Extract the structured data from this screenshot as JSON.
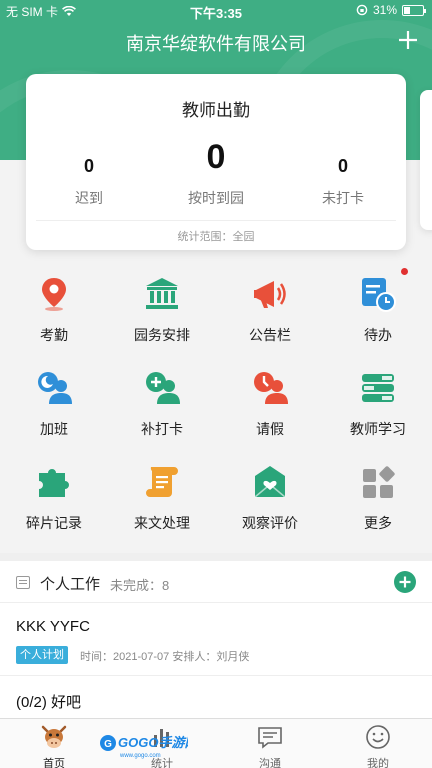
{
  "status_bar": {
    "carrier": "无 SIM 卡",
    "time": "下午3:35",
    "battery": "31%",
    "battery_level": 0.31
  },
  "header": {
    "title": "南京华绽软件有限公司",
    "add_icon": "plus-icon"
  },
  "attendance": {
    "title": "教师出勤",
    "stats": [
      {
        "value": "0",
        "label": "迟到"
      },
      {
        "value": "0",
        "label": "按时到园"
      },
      {
        "value": "0",
        "label": "未打卡"
      }
    ],
    "scope": "统计范围：全园"
  },
  "menu": [
    {
      "label": "考勤",
      "icon": "location-pin-icon",
      "color": "#e8503a"
    },
    {
      "label": "园务安排",
      "icon": "building-icon",
      "color": "#2aa57a"
    },
    {
      "label": "公告栏",
      "icon": "megaphone-icon",
      "color": "#e8503a"
    },
    {
      "label": "待办",
      "icon": "todo-clock-icon",
      "color": "#2f8fd8"
    },
    {
      "label": "加班",
      "icon": "overtime-user-icon",
      "color": "#2f8fd8"
    },
    {
      "label": "补打卡",
      "icon": "add-user-icon",
      "color": "#2aa57a"
    },
    {
      "label": "请假",
      "icon": "leave-user-icon",
      "color": "#e8503a"
    },
    {
      "label": "教师学习",
      "icon": "book-stack-icon",
      "color": "#2aa57a"
    },
    {
      "label": "碎片记录",
      "icon": "puzzle-icon",
      "color": "#2aa57a"
    },
    {
      "label": "来文处理",
      "icon": "scroll-icon",
      "color": "#f0a030"
    },
    {
      "label": "观察评价",
      "icon": "heart-envelope-icon",
      "color": "#2aa57a"
    },
    {
      "label": "更多",
      "icon": "more-grid-icon",
      "color": "#999999"
    }
  ],
  "work": {
    "title": "个人工作",
    "pending": "未完成：8",
    "tasks": [
      {
        "name": "KKK YYFC",
        "tag": "个人计划",
        "meta": "时间：2021-07-07   安排人：刘月侠"
      },
      {
        "name": "(0/2) 好吧"
      }
    ]
  },
  "tabs": [
    {
      "label": "首页",
      "icon": "cow-mascot-icon"
    },
    {
      "label": "统计",
      "icon": "stats-icon"
    },
    {
      "label": "沟通",
      "icon": "chat-icon"
    },
    {
      "label": "我的",
      "icon": "smile-face-icon"
    }
  ],
  "watermark": {
    "text": "GOGO手游网",
    "sub": "www.gogo.com"
  },
  "colors": {
    "brand": "#3fae84",
    "accent": "#2aa57a"
  }
}
